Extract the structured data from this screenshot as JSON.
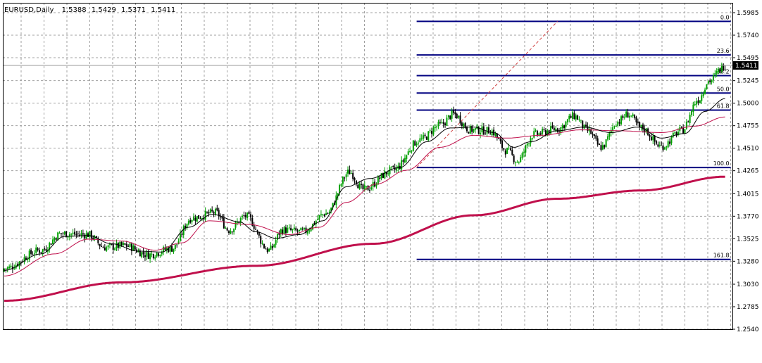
{
  "header": {
    "symbol": "EURUSD,Daily",
    "open": "1.5388",
    "high": "1.5429",
    "low": "1.5371",
    "close": "1.5411"
  },
  "colors": {
    "background": "#ffffff",
    "grid": "#a0a0a0",
    "bull_candle": "#00a000",
    "bear_candle": "#000000",
    "fast_ma": "#000000",
    "mid_ma": "#c0104c",
    "slow_ma": "#c0104c",
    "fib_levels": "#000080",
    "trend_line": "#d04040",
    "price_label_bg": "#000000",
    "price_label_text": "#ffffff"
  },
  "chart_data": {
    "type": "candlestick",
    "y_axis": {
      "position": "right",
      "range": [
        1.254,
        1.5985
      ],
      "ticks": [
        "1.5985",
        "1.5740",
        "1.5495",
        "1.5245",
        "1.5000",
        "1.4755",
        "1.4510",
        "1.4265",
        "1.4015",
        "1.3770",
        "1.3525",
        "1.3280",
        "1.3030",
        "1.2785",
        "1.2540"
      ]
    },
    "current_price": "1.5411",
    "grid": true,
    "series": {
      "candles_key_closes": [
        [
          0,
          1.32
        ],
        [
          22,
          1.34
        ],
        [
          34,
          1.358
        ],
        [
          50,
          1.357
        ],
        [
          60,
          1.343
        ],
        [
          72,
          1.345
        ],
        [
          86,
          1.335
        ],
        [
          100,
          1.342
        ],
        [
          112,
          1.375
        ],
        [
          126,
          1.381
        ],
        [
          134,
          1.362
        ],
        [
          144,
          1.377
        ],
        [
          158,
          1.34
        ],
        [
          166,
          1.362
        ],
        [
          178,
          1.36
        ],
        [
          192,
          1.38
        ],
        [
          206,
          1.425
        ],
        [
          214,
          1.406
        ],
        [
          232,
          1.427
        ],
        [
          248,
          1.46
        ],
        [
          260,
          1.476
        ],
        [
          268,
          1.488
        ],
        [
          278,
          1.471
        ],
        [
          290,
          1.47
        ],
        [
          300,
          1.448
        ],
        [
          306,
          1.437
        ],
        [
          316,
          1.466
        ],
        [
          330,
          1.472
        ],
        [
          340,
          1.486
        ],
        [
          348,
          1.47
        ],
        [
          356,
          1.452
        ],
        [
          366,
          1.48
        ],
        [
          372,
          1.488
        ],
        [
          380,
          1.473
        ],
        [
          392,
          1.453
        ],
        [
          404,
          1.47
        ],
        [
          414,
          1.504
        ],
        [
          420,
          1.524
        ],
        [
          430,
          1.541
        ]
      ],
      "fast_ma_key": [
        [
          0,
          1.318
        ],
        [
          22,
          1.336
        ],
        [
          36,
          1.355
        ],
        [
          50,
          1.356
        ],
        [
          64,
          1.347
        ],
        [
          80,
          1.339
        ],
        [
          94,
          1.338
        ],
        [
          110,
          1.365
        ],
        [
          124,
          1.379
        ],
        [
          140,
          1.371
        ],
        [
          150,
          1.36
        ],
        [
          162,
          1.353
        ],
        [
          176,
          1.357
        ],
        [
          190,
          1.372
        ],
        [
          204,
          1.409
        ],
        [
          218,
          1.418
        ],
        [
          236,
          1.43
        ],
        [
          252,
          1.458
        ],
        [
          266,
          1.473
        ],
        [
          280,
          1.474
        ],
        [
          292,
          1.468
        ],
        [
          304,
          1.452
        ],
        [
          314,
          1.458
        ],
        [
          330,
          1.47
        ],
        [
          346,
          1.474
        ],
        [
          362,
          1.468
        ],
        [
          378,
          1.474
        ],
        [
          392,
          1.462
        ],
        [
          406,
          1.467
        ],
        [
          418,
          1.491
        ],
        [
          430,
          1.505
        ]
      ],
      "mid_ma_key": [
        [
          0,
          1.312
        ],
        [
          30,
          1.336
        ],
        [
          50,
          1.352
        ],
        [
          70,
          1.35
        ],
        [
          90,
          1.34
        ],
        [
          106,
          1.348
        ],
        [
          122,
          1.372
        ],
        [
          146,
          1.368
        ],
        [
          170,
          1.357
        ],
        [
          188,
          1.365
        ],
        [
          204,
          1.392
        ],
        [
          222,
          1.412
        ],
        [
          240,
          1.427
        ],
        [
          260,
          1.452
        ],
        [
          280,
          1.465
        ],
        [
          300,
          1.462
        ],
        [
          320,
          1.465
        ],
        [
          344,
          1.471
        ],
        [
          366,
          1.47
        ],
        [
          392,
          1.468
        ],
        [
          412,
          1.475
        ],
        [
          430,
          1.485
        ]
      ],
      "slow_ma_key": [
        [
          0,
          1.285
        ],
        [
          70,
          1.305
        ],
        [
          150,
          1.323
        ],
        [
          220,
          1.347
        ],
        [
          280,
          1.378
        ],
        [
          330,
          1.396
        ],
        [
          380,
          1.405
        ],
        [
          430,
          1.42
        ]
      ]
    },
    "fibonacci": [
      {
        "label": "0.0",
        "price": 1.589
      },
      {
        "label": "23.6",
        "price": 1.5525
      },
      {
        "label": "38.2",
        "price": 1.53
      },
      {
        "label": "50.0",
        "price": 1.511
      },
      {
        "label": "61.8",
        "price": 1.4925
      },
      {
        "label": "100.0",
        "price": 1.43
      },
      {
        "label": "161.8",
        "price": 1.33
      }
    ],
    "trend_line": {
      "from": [
        246,
        1.43
      ],
      "to": [
        330,
        1.589
      ]
    }
  }
}
